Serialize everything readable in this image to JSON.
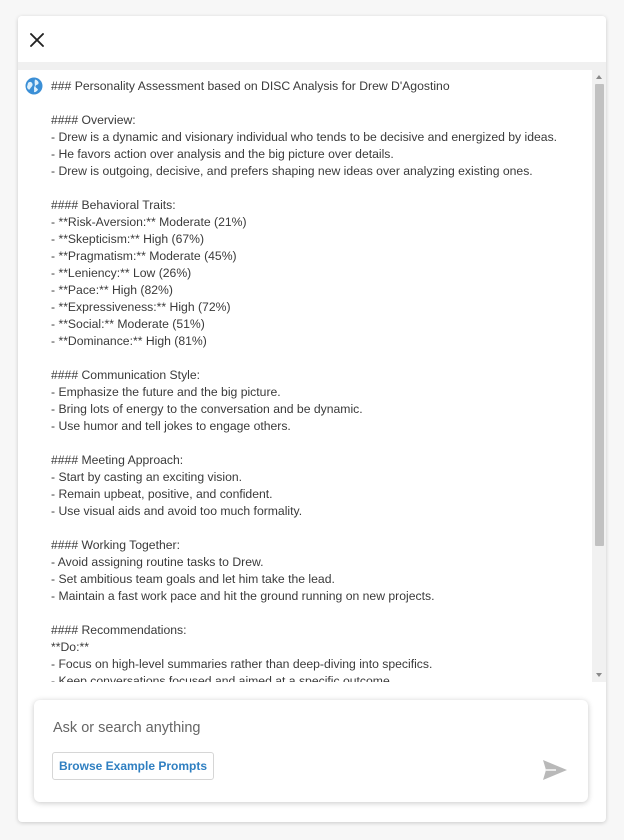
{
  "header": {
    "close_icon": "close-icon"
  },
  "message": {
    "avatar_icon": "assistant-globe-icon",
    "lines": [
      "### Personality Assessment based on DISC Analysis for Drew D'Agostino",
      "",
      "#### Overview:",
      "- Drew is a dynamic and visionary individual who tends to be decisive and energized by ideas.",
      "- He favors action over analysis and the big picture over details.",
      "- Drew is outgoing, decisive, and prefers shaping new ideas over analyzing existing ones.",
      "",
      "#### Behavioral Traits:",
      "- **Risk-Aversion:** Moderate (21%)",
      "- **Skepticism:** High (67%)",
      "- **Pragmatism:** Moderate (45%)",
      "- **Leniency:** Low (26%)",
      "- **Pace:** High (82%)",
      "- **Expressiveness:** High (72%)",
      "- **Social:** Moderate (51%)",
      "- **Dominance:** High (81%)",
      "",
      "#### Communication Style:",
      "- Emphasize the future and the big picture.",
      "- Bring lots of energy to the conversation and be dynamic.",
      "- Use humor and tell jokes to engage others.",
      "",
      "#### Meeting Approach:",
      "- Start by casting an exciting vision.",
      "- Remain upbeat, positive, and confident.",
      "- Use visual aids and avoid too much formality.",
      "",
      "#### Working Together:",
      "- Avoid assigning routine tasks to Drew.",
      "- Set ambitious team goals and let him take the lead.",
      "- Maintain a fast work pace and hit the ground running on new projects.",
      "",
      "#### Recommendations:",
      "**Do:**",
      "- Focus on high-level summaries rather than deep-diving into specifics.",
      "- Keep conversations focused and aimed at a specific outcome."
    ]
  },
  "composer": {
    "placeholder": "Ask or search anything",
    "value": "",
    "browse_label": "Browse Example Prompts",
    "send_icon": "send-icon"
  },
  "colors": {
    "accent": "#2f7fc1",
    "send_icon": "#b9b9b9",
    "scroll_thumb": "#c1c1c1"
  }
}
